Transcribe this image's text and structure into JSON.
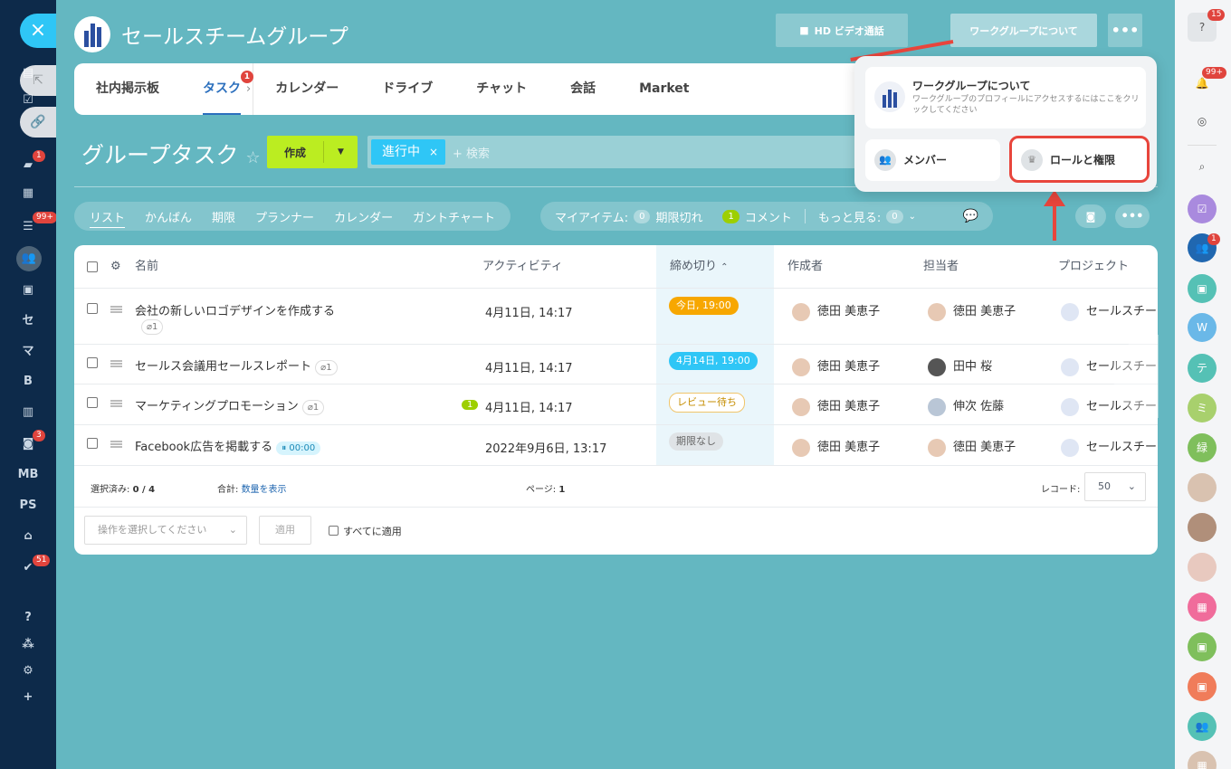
{
  "group": {
    "name": "セールスチームグループ"
  },
  "header": {
    "video_call": "HD ビデオ通話",
    "about": "ワークグループについて"
  },
  "tabs": [
    {
      "label": "社内掲示板"
    },
    {
      "label": "タスク",
      "badge": "1"
    },
    {
      "label": "カレンダー"
    },
    {
      "label": "ドライブ"
    },
    {
      "label": "チャット"
    },
    {
      "label": "会話"
    },
    {
      "label": "Market"
    }
  ],
  "page": {
    "title": "グループタスク",
    "create": "作成"
  },
  "search": {
    "chip": "進行中",
    "placeholder": "+ 検索"
  },
  "views": [
    "リスト",
    "かんばん",
    "期限",
    "プランナー",
    "カレンダー",
    "ガントチャート"
  ],
  "counters": {
    "my_items": "マイアイテム:",
    "overdue_count": "0",
    "overdue": "期限切れ",
    "comment_count": "1",
    "comment": "コメント",
    "more": "もっと見る:",
    "more_count": "0"
  },
  "columns": {
    "name": "名前",
    "activity": "アクティビティ",
    "deadline": "締め切り",
    "creator": "作成者",
    "assignee": "担当者",
    "project": "プロジェクト"
  },
  "rows": [
    {
      "name": "会社の新しいロゴデザインを作成する",
      "clip": "1",
      "activity": "4月11日, 14:17",
      "deadline": "今日, 19:00",
      "creator": "徳田 美恵子",
      "assignee": "徳田 美恵子",
      "project": "セールスチー"
    },
    {
      "name": "セールス会議用セールスレポート",
      "clip": "1",
      "activity": "4月11日, 14:17",
      "deadline": "4月14日, 19:00",
      "creator": "徳田 美恵子",
      "assignee": "田中 桜",
      "project": "セールスチー"
    },
    {
      "name": "マーケティングプロモーション",
      "clip": "1",
      "comments": "1",
      "activity": "4月11日, 14:17",
      "deadline": "レビュー待ち",
      "creator": "徳田 美恵子",
      "assignee": "伸次 佐藤",
      "project": "セールスチー"
    },
    {
      "name": "Facebook広告を掲載する",
      "timer": "00:00",
      "activity": "2022年9月6日, 13:17",
      "deadline": "期限なし",
      "creator": "徳田 美恵子",
      "assignee": "徳田 美恵子",
      "project": "セールスチー"
    }
  ],
  "footer": {
    "selected_label": "選択済み:",
    "selected": "0 / 4",
    "total_label": "合計:",
    "total_link": "数量を表示",
    "page_label": "ページ:",
    "page": "1",
    "records_label": "レコード:",
    "records": "50",
    "action_placeholder": "操作を選択してください",
    "apply": "適用",
    "apply_all": "すべてに適用"
  },
  "popup": {
    "about_title": "ワークグループについて",
    "about_desc": "ワークグループのプロフィールにアクセスするにはここをクリックしてください",
    "members": "メンバー",
    "roles": "ロールと権限"
  },
  "left_nav": {
    "letters": [
      "セ",
      "マ",
      "B",
      "MB",
      "PS"
    ],
    "badges": [
      "1",
      "99+",
      "3",
      "51"
    ]
  },
  "right_nav": {
    "help_badge": "15",
    "bell_badge": "99+",
    "group_badge": "1",
    "w": "W",
    "te": "テ",
    "mi": "ミ",
    "green": "緑"
  },
  "colors": {
    "accent": "#2fc6f6",
    "create": "#bbed21",
    "highlight": "#e8453c"
  }
}
